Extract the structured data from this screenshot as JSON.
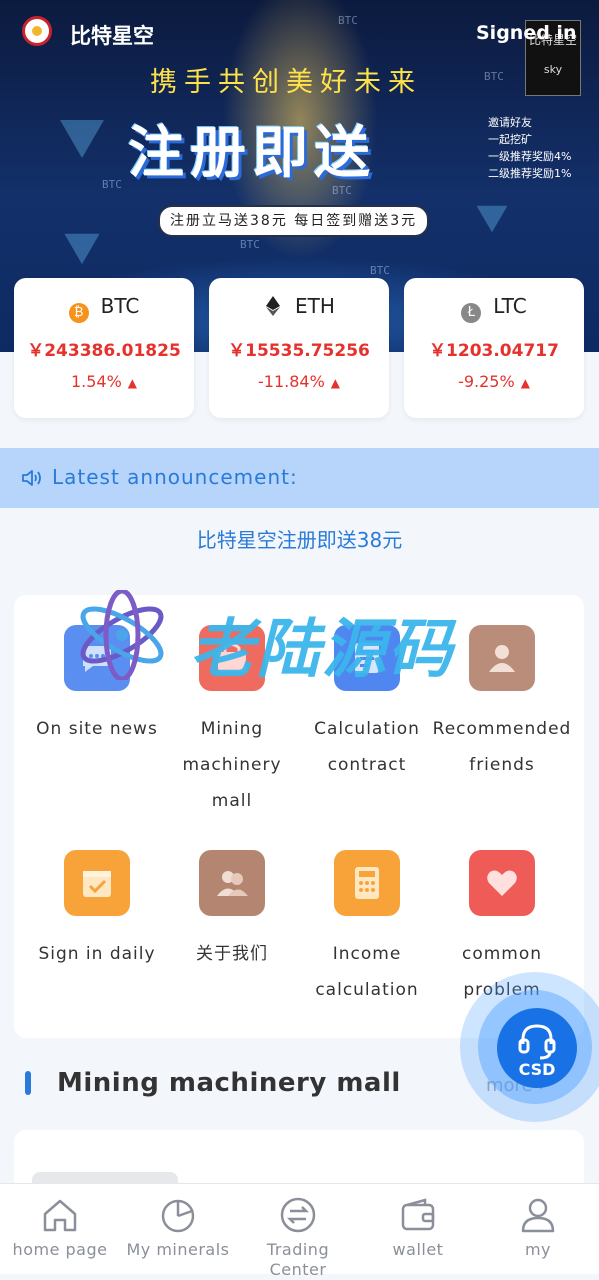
{
  "header": {
    "app_title": "比特星空",
    "signed_in_label": "Signed in",
    "badge_top": "比特星空",
    "badge_bottom": "sky"
  },
  "banner": {
    "slogan": "携手共创美好未来",
    "headline": "注册即送",
    "promo_lines": [
      "邀请好友",
      "一起挖矿",
      "一级推荐奖励4%",
      "二级推荐奖励1%"
    ],
    "pill_text": "注册立马送38元  每日签到赠送3元",
    "bg_tags": [
      "BTC",
      "BTC",
      "BTC",
      "BTC",
      "BTC",
      "BTC"
    ]
  },
  "tickers": [
    {
      "symbol": "BTC",
      "price": "￥243386.01825",
      "change": "1.54%",
      "icon": "bitcoin-icon",
      "color": "#f7931a"
    },
    {
      "symbol": "ETH",
      "price": "￥15535.75256",
      "change": "-11.84%",
      "icon": "ethereum-icon",
      "color": "#222222"
    },
    {
      "symbol": "LTC",
      "price": "￥1203.04717",
      "change": "-9.25%",
      "icon": "litecoin-icon",
      "color": "#888888"
    }
  ],
  "announcement": {
    "label": "Latest announcement:",
    "text": "比特星空注册即送38元"
  },
  "menu": [
    {
      "label": "On site news",
      "icon": "chat-icon",
      "color": "#5a8ef0"
    },
    {
      "label": "Mining machinery mall",
      "icon": "shop-icon",
      "color": "#ef6a5f"
    },
    {
      "label": "Calculation contract",
      "icon": "contract-icon",
      "color": "#4f86ef"
    },
    {
      "label": "Recommended friends",
      "icon": "friends-icon",
      "color": "#b98d7a"
    },
    {
      "label": "Sign in daily",
      "icon": "calendar-check-icon",
      "color": "#f8a33a"
    },
    {
      "label": "关于我们",
      "icon": "users-icon",
      "color": "#b48672"
    },
    {
      "label": "Income calculation",
      "icon": "calculator-icon",
      "color": "#f8a33a"
    },
    {
      "label": "common problem",
      "icon": "heart-icon",
      "color": "#ef5b57"
    }
  ],
  "watermark": "老陆源码",
  "section": {
    "title": "Mining machinery mall",
    "more_label": "more"
  },
  "support": {
    "label": "CSD"
  },
  "tabbar": [
    {
      "label": "home page",
      "icon": "home-icon"
    },
    {
      "label": "My minerals",
      "icon": "pie-chart-icon"
    },
    {
      "label": "Trading Center",
      "icon": "exchange-icon"
    },
    {
      "label": "wallet",
      "icon": "wallet-icon"
    },
    {
      "label": "my",
      "icon": "user-icon"
    }
  ],
  "colors": {
    "accent": "#2a7bd9",
    "price_red": "#e5322d",
    "announce_bg": "#b7d4fb",
    "csd_blue": "#1872e6"
  }
}
